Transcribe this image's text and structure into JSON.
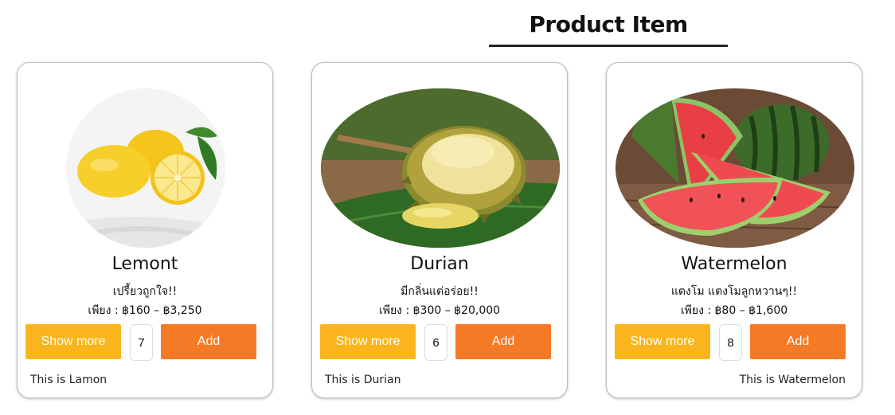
{
  "header": {
    "title": "Product Item"
  },
  "products": [
    {
      "name": "Lemont",
      "tagline": "เปรี้ยวถูกใจ!!",
      "price": "เพียง : ฿160 – ฿3,250",
      "show_more_label": "Show more",
      "quantity": "7",
      "add_label": "Add",
      "note": "This is Lamon",
      "image_icon": "lemon-image"
    },
    {
      "name": "Durian",
      "tagline": "มีกลิ่นแต่อร่อย!!",
      "price": "เพียง : ฿300 – ฿20,000",
      "show_more_label": "Show more",
      "quantity": "6",
      "add_label": "Add",
      "note": "This is Durian",
      "image_icon": "durian-image"
    },
    {
      "name": "Watermelon",
      "tagline": "แตงโม แตงโมลูกหวานๆ!!",
      "price": "เพียง : ฿80 – ฿1,600",
      "show_more_label": "Show more",
      "quantity": "8",
      "add_label": "Add",
      "note": "This is Watermelon",
      "image_icon": "watermelon-image"
    }
  ],
  "colors": {
    "show_more_bg": "#f9b51b",
    "add_bg": "#f57a26",
    "heading_rule": "#222222"
  }
}
